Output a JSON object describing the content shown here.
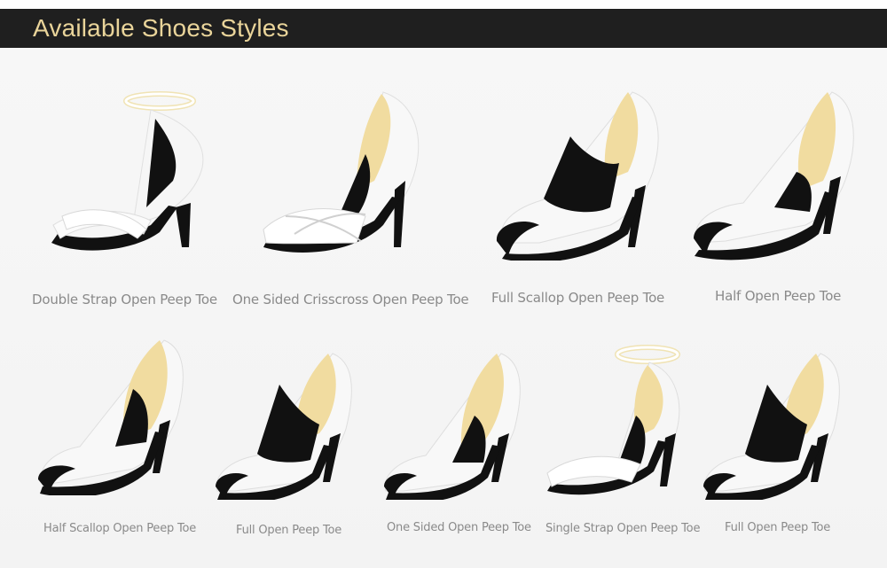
{
  "header": {
    "title": "Available Shoes Styles"
  },
  "colors": {
    "header_bg": "#1f1f1f",
    "title": "#e9d49a",
    "label": "#8a8a8a",
    "lining": "#f1dca0"
  },
  "styles": [
    {
      "label": "Double Strap Open Peep Toe",
      "icon": "double-strap-shoe"
    },
    {
      "label": "One Sided Crisscross Open Peep Toe",
      "icon": "crisscross-shoe"
    },
    {
      "label": "Full Scallop Open Peep Toe",
      "icon": "full-scallop-shoe"
    },
    {
      "label": "Half Open Peep Toe",
      "icon": "half-open-shoe"
    },
    {
      "label": "Half Scallop Open Peep Toe",
      "icon": "half-scallop-shoe"
    },
    {
      "label": "Full Open Peep Toe",
      "icon": "full-open-shoe"
    },
    {
      "label": "One Sided Open Peep Toe",
      "icon": "one-sided-shoe"
    },
    {
      "label": "Single Strap Open Peep Toe",
      "icon": "single-strap-shoe"
    },
    {
      "label": "Full Open Peep Toe",
      "icon": "full-open-shoe"
    }
  ]
}
